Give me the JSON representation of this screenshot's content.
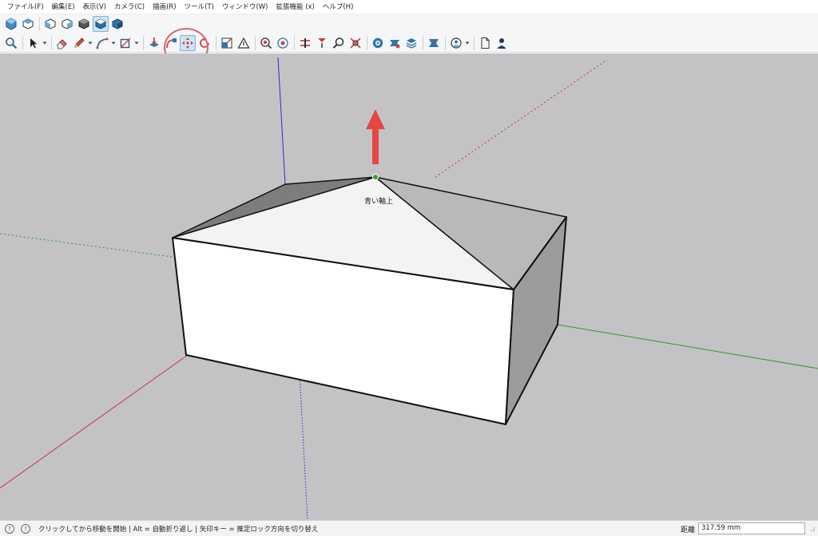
{
  "menu": [
    {
      "label": "ファイル(F)",
      "name": "menu-file"
    },
    {
      "label": "編集(E)",
      "name": "menu-edit"
    },
    {
      "label": "表示(V)",
      "name": "menu-view"
    },
    {
      "label": "カメラ(C)",
      "name": "menu-camera"
    },
    {
      "label": "描画(R)",
      "name": "menu-draw"
    },
    {
      "label": "ツール(T)",
      "name": "menu-tools"
    },
    {
      "label": "ウィンドウ(W)",
      "name": "menu-window"
    },
    {
      "label": "拡張機能 (x)",
      "name": "menu-extensions"
    },
    {
      "label": "ヘルプ(H)",
      "name": "menu-help"
    }
  ],
  "toolbar_views": [
    "iso-view-icon",
    "top-view-icon",
    "front-view-icon",
    "right-view-icon",
    "back-view-icon",
    "left-view-icon",
    "style-shaded-icon",
    "style-textured-icon"
  ],
  "toolbar_tools": [
    "zoom-icon",
    "select-icon",
    "eraser-icon",
    "pencil-icon",
    "arc-icon",
    "rectangle-icon",
    "push-pull-icon",
    "follow-me-icon",
    "move-icon",
    "rotate-icon",
    "scale-icon",
    "tape-measure-icon",
    "text-icon",
    "orbit-icon",
    "pan-icon",
    "zoom-extents-icon",
    "warehouse-icon",
    "extension-warehouse-icon",
    "layers-icon",
    "sandbox-icon",
    "model-info-icon",
    "user-icon"
  ],
  "active_tool": "move-icon",
  "viewport": {
    "inference_label": "青い軸上",
    "colors": {
      "background": "#c3c3c5",
      "red_axis": "#cc3333",
      "green_axis": "#2e9a2e",
      "blue_axis": "#2b2bcc",
      "arrow": "#e84545",
      "inference_point": "#3a9a3a"
    }
  },
  "status": {
    "message": "クリックしてから移動を開始 | Alt = 自動折り返し | 矢印キー = 推定ロック方向を切り替え",
    "measure_label": "距離",
    "measure_value": "317.59 mm"
  }
}
